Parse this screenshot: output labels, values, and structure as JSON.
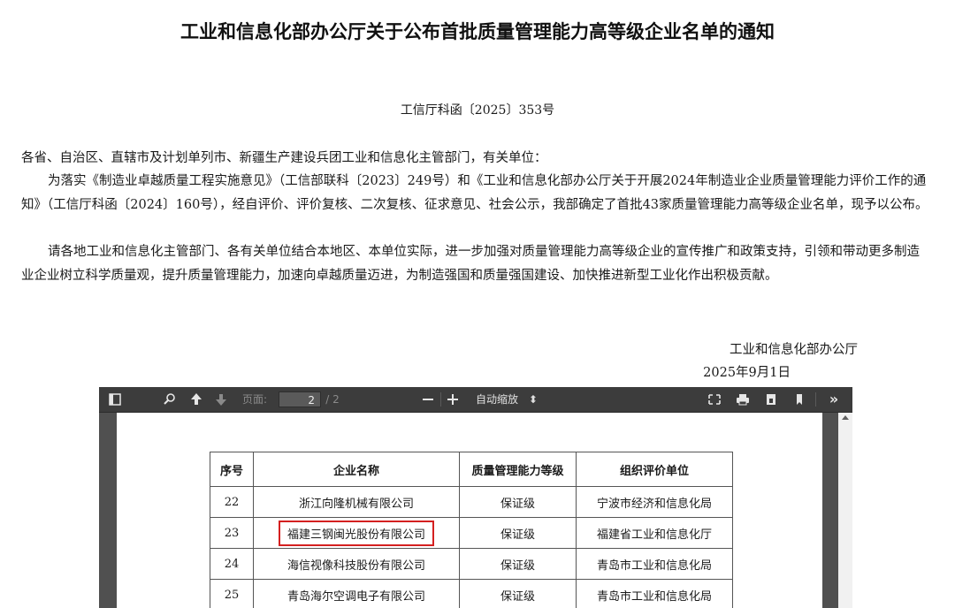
{
  "document": {
    "title": "工业和信息化部办公厅关于公布首批质量管理能力高等级企业名单的通知",
    "doc_number": "工信厅科函〔2025〕353号",
    "addressee": "各省、自治区、直辖市及计划单列市、新疆生产建设兵团工业和信息化主管部门，有关单位：",
    "para1": "为落实《制造业卓越质量工程实施意见》（工信部联科〔2023〕249号）和《工业和信息化部办公厅关于开展2024年制造业企业质量管理能力评价工作的通知》（工信厅科函〔2024〕160号），经自评价、评价复核、二次复核、征求意见、社会公示，我部确定了首批43家质量管理能力高等级企业名单，现予以公布。",
    "para2": "请各地工业和信息化主管部门、各有关单位结合本地区、本单位实际，进一步加强对质量管理能力高等级企业的宣传推广和政策支持，引领和带动更多制造业企业树立科学质量观，提升质量管理能力，加速向卓越质量迈进，为制造强国和质量强国建设、加快推进新型工业化作出积极贡献。",
    "signature": "工业和信息化部办公厅",
    "date": "2025年9月1日"
  },
  "viewer": {
    "page_label": "页面:",
    "page_value": "2",
    "page_total": "/ 2",
    "zoom_label": "自动缩放",
    "icons": [
      "sidebar-toggle-icon",
      "search-icon",
      "prev-page-icon",
      "next-page-icon",
      "zoom-out-icon",
      "zoom-in-icon",
      "presentation-icon",
      "print-icon",
      "download-icon",
      "bookmark-icon",
      "more-tools-icon"
    ]
  },
  "table": {
    "headers": [
      "序号",
      "企业名称",
      "质量管理能力等级",
      "组织评价单位"
    ],
    "rows": [
      [
        "22",
        "浙江向隆机械有限公司",
        "保证级",
        "宁波市经济和信息化局"
      ],
      [
        "23",
        "福建三钢闽光股份有限公司",
        "保证级",
        "福建省工业和信息化厅"
      ],
      [
        "24",
        "海信视像科技股份有限公司",
        "保证级",
        "青岛市工业和信息化局"
      ],
      [
        "25",
        "青岛海尔空调电子有限公司",
        "保证级",
        "青岛市工业和信息化局"
      ]
    ],
    "highlight_color": "#d42020"
  }
}
